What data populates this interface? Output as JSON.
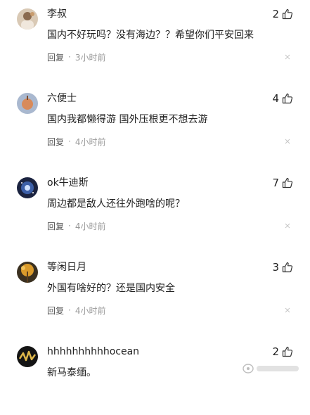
{
  "comments": [
    {
      "user": "李叔",
      "likes": "2",
      "text": "国内不好玩吗？没有海边？？希望你们平安回来",
      "reply": "回复",
      "dot": "·",
      "time": "3小时前"
    },
    {
      "user": "六便士",
      "likes": "4",
      "text": "国内我都懒得游 国外压根更不想去游",
      "reply": "回复",
      "dot": "·",
      "time": "4小时前"
    },
    {
      "user": "ok牛迪斯",
      "likes": "7",
      "text": "周边都是敌人还往外跑啥的呢？",
      "reply": "回复",
      "dot": "·",
      "time": "4小时前"
    },
    {
      "user": "等闲日月",
      "likes": "3",
      "text": "外国有啥好的？还是国内安全",
      "reply": "回复",
      "dot": "·",
      "time": "4小时前"
    },
    {
      "user": "hhhhhhhhhhocean",
      "likes": "2",
      "text": "新马泰缅。"
    }
  ],
  "icons": {
    "like": "thumbs-up-icon",
    "dismiss": "close-icon"
  },
  "colors": {
    "text": "#222222",
    "meta": "#999999",
    "background": "#ffffff"
  }
}
